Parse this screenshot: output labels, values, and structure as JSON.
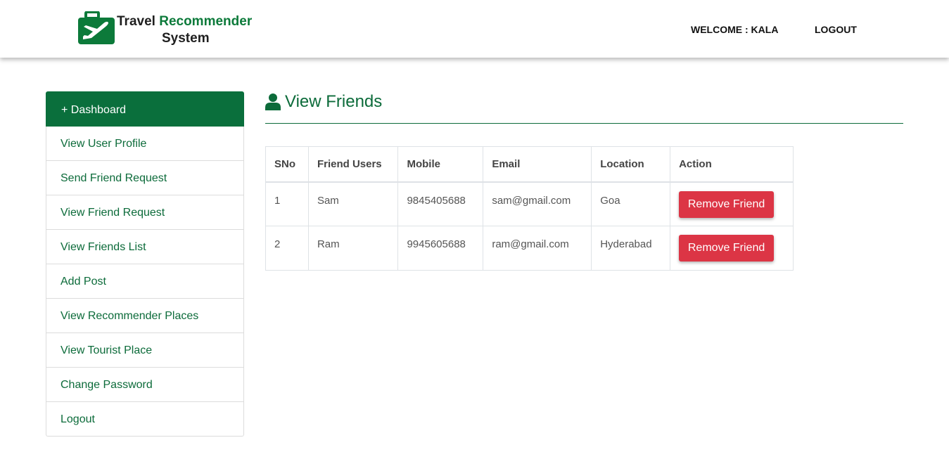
{
  "header": {
    "logo_word1": "Travel",
    "logo_word2": "Recommender",
    "logo_line2": "System",
    "welcome": "WELCOME : KALA",
    "logout": "LOGOUT"
  },
  "sidebar": {
    "items": [
      {
        "label": "+ Dashboard",
        "active": true
      },
      {
        "label": "View User Profile"
      },
      {
        "label": "Send Friend Request"
      },
      {
        "label": "View Friend Request"
      },
      {
        "label": "View Friends List"
      },
      {
        "label": "Add Post"
      },
      {
        "label": "View Recommender Places"
      },
      {
        "label": "View Tourist Place"
      },
      {
        "label": "Change Password"
      },
      {
        "label": "Logout"
      }
    ]
  },
  "main": {
    "title": "View Friends",
    "table": {
      "headers": [
        "SNo",
        "Friend Users",
        "Mobile",
        "Email",
        "Location",
        "Action"
      ],
      "rows": [
        {
          "sno": "1",
          "user": "Sam",
          "mobile": "9845405688",
          "email": "sam@gmail.com",
          "location": "Goa",
          "action": "Remove Friend"
        },
        {
          "sno": "2",
          "user": "Ram",
          "mobile": "9945605688",
          "email": "ram@gmail.com",
          "location": "Hyderabad",
          "action": "Remove Friend"
        }
      ]
    }
  },
  "colors": {
    "brand_green": "#0a6f3c",
    "danger_red": "#dc3545"
  },
  "icons": {
    "logo": "suitcase-plane-icon",
    "title": "user-icon"
  }
}
